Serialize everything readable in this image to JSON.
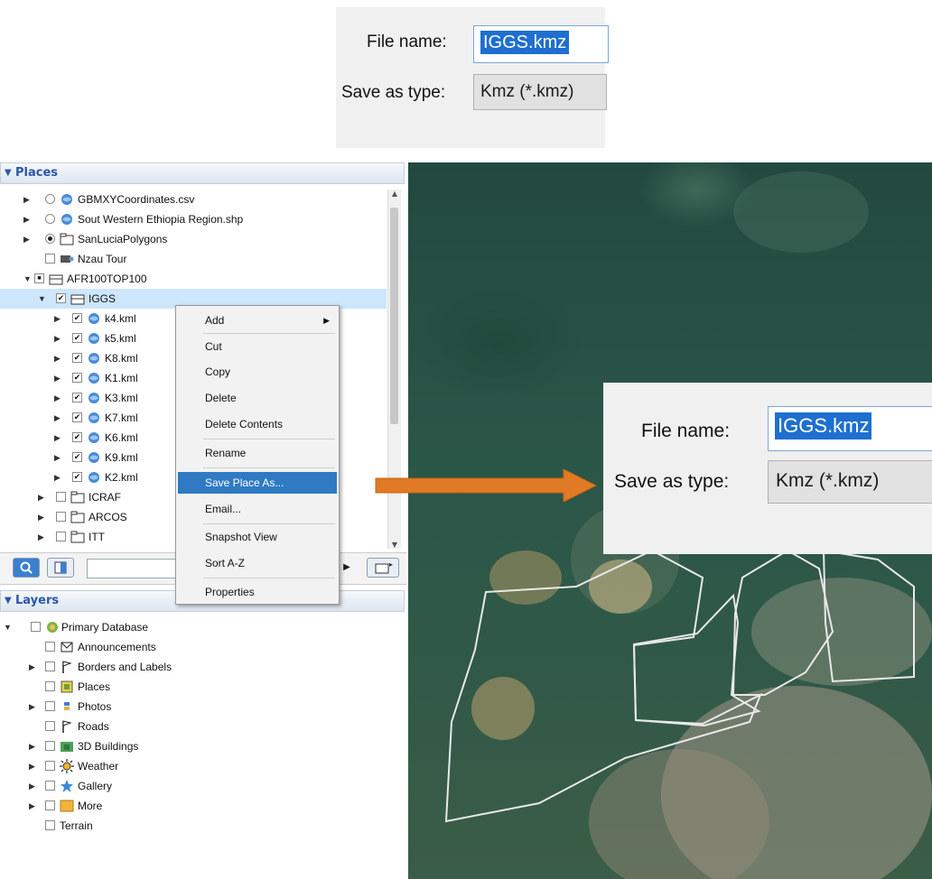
{
  "save_dialog": {
    "file_name_label": "File name:",
    "file_name_value": "IGGS.kmz",
    "save_as_type_label": "Save as type:",
    "save_as_type_value": "Kmz (*.kmz)"
  },
  "places": {
    "header": "Places",
    "items": [
      {
        "label": "GBMXYCoordinates.csv",
        "icon": "kml-layer-icon"
      },
      {
        "label": "Sout Western Ethiopia Region.shp",
        "icon": "kml-layer-icon"
      },
      {
        "label": "SanLuciaPolygons",
        "icon": "folder-icon"
      },
      {
        "label": "Nzau Tour",
        "icon": "tour-icon"
      },
      {
        "label": "AFR100TOP100",
        "icon": "open-folder-icon"
      },
      {
        "label": "IGGS",
        "icon": "open-folder-icon"
      },
      {
        "label": "k4.kml",
        "icon": "kml-layer-icon"
      },
      {
        "label": "k5.kml",
        "icon": "kml-layer-icon"
      },
      {
        "label": "K8.kml",
        "icon": "kml-layer-icon"
      },
      {
        "label": "K1.kml",
        "icon": "kml-layer-icon"
      },
      {
        "label": "K3.kml",
        "icon": "kml-layer-icon"
      },
      {
        "label": "K7.kml",
        "icon": "kml-layer-icon"
      },
      {
        "label": "K6.kml",
        "icon": "kml-layer-icon"
      },
      {
        "label": "K9.kml",
        "icon": "kml-layer-icon"
      },
      {
        "label": "K2.kml",
        "icon": "kml-layer-icon"
      },
      {
        "label": "ICRAF",
        "icon": "folder-icon"
      },
      {
        "label": "ARCOS",
        "icon": "folder-icon"
      },
      {
        "label": "ITT",
        "icon": "folder-icon"
      }
    ]
  },
  "context_menu": {
    "items": [
      "Add",
      "Cut",
      "Copy",
      "Delete",
      "Delete Contents",
      "Rename",
      "Save Place As...",
      "Email...",
      "Snapshot View",
      "Sort A-Z",
      "Properties"
    ],
    "highlighted": "Save Place As..."
  },
  "layers": {
    "header": "Layers",
    "items": [
      {
        "label": "Primary Database",
        "icon": "database-icon"
      },
      {
        "label": "Announcements",
        "icon": "envelope-icon"
      },
      {
        "label": "Borders and Labels",
        "icon": "flag-icon"
      },
      {
        "label": "Places",
        "icon": "places-icon"
      },
      {
        "label": "Photos",
        "icon": "photo-icon"
      },
      {
        "label": "Roads",
        "icon": "road-sign-icon"
      },
      {
        "label": "3D Buildings",
        "icon": "building-icon"
      },
      {
        "label": "Weather",
        "icon": "sun-icon"
      },
      {
        "label": "Gallery",
        "icon": "star-icon"
      },
      {
        "label": "More",
        "icon": "more-icon"
      },
      {
        "label": "Terrain",
        "icon": ""
      }
    ]
  },
  "colors": {
    "selection": "#1f6fd0",
    "menu_highlight": "#2f7ac2",
    "arrow": "#e07a24",
    "polygon_outline": "#e8e8e8"
  }
}
